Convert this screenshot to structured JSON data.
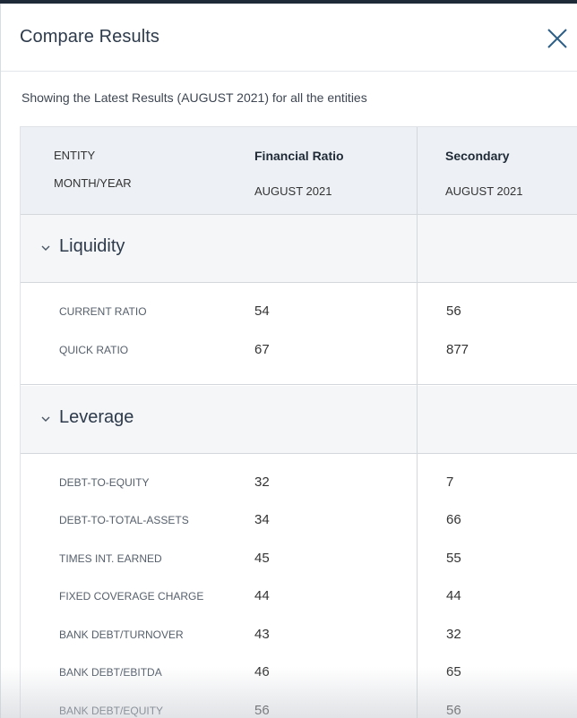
{
  "modal": {
    "title": "Compare Results",
    "subtitle": "Showing the Latest Results (AUGUST 2021) for all the entities"
  },
  "table": {
    "header": {
      "entity_label": "ENTITY",
      "month_label": "MONTH/YEAR",
      "columns": [
        {
          "name": "Financial Ratio",
          "date": "AUGUST 2021"
        },
        {
          "name": "Secondary",
          "date": "AUGUST 2021"
        }
      ]
    },
    "sections": [
      {
        "label": "Liquidity",
        "rows": [
          {
            "metric": "CURRENT RATIO",
            "values": [
              "54",
              "56"
            ]
          },
          {
            "metric": "QUICK RATIO",
            "values": [
              "67",
              "877"
            ]
          }
        ]
      },
      {
        "label": "Leverage",
        "rows": [
          {
            "metric": "DEBT-TO-EQUITY",
            "values": [
              "32",
              "7"
            ]
          },
          {
            "metric": "DEBT-TO-TOTAL-ASSETS",
            "values": [
              "34",
              "66"
            ]
          },
          {
            "metric": "TIMES INT. EARNED",
            "values": [
              "45",
              "55"
            ]
          },
          {
            "metric": "FIXED COVERAGE CHARGE",
            "values": [
              "44",
              "44"
            ]
          },
          {
            "metric": "BANK DEBT/TURNOVER",
            "values": [
              "43",
              "32"
            ]
          },
          {
            "metric": "BANK DEBT/EBITDA",
            "values": [
              "46",
              "65"
            ]
          },
          {
            "metric": "BANK DEBT/EQUITY",
            "values": [
              "56",
              "56"
            ]
          }
        ]
      }
    ]
  },
  "colors": {
    "header_bg": "#edf1f5",
    "section_bg": "#f5f6f8",
    "title_text": "#2d3a4b",
    "close_icon": "#2f5f86"
  }
}
